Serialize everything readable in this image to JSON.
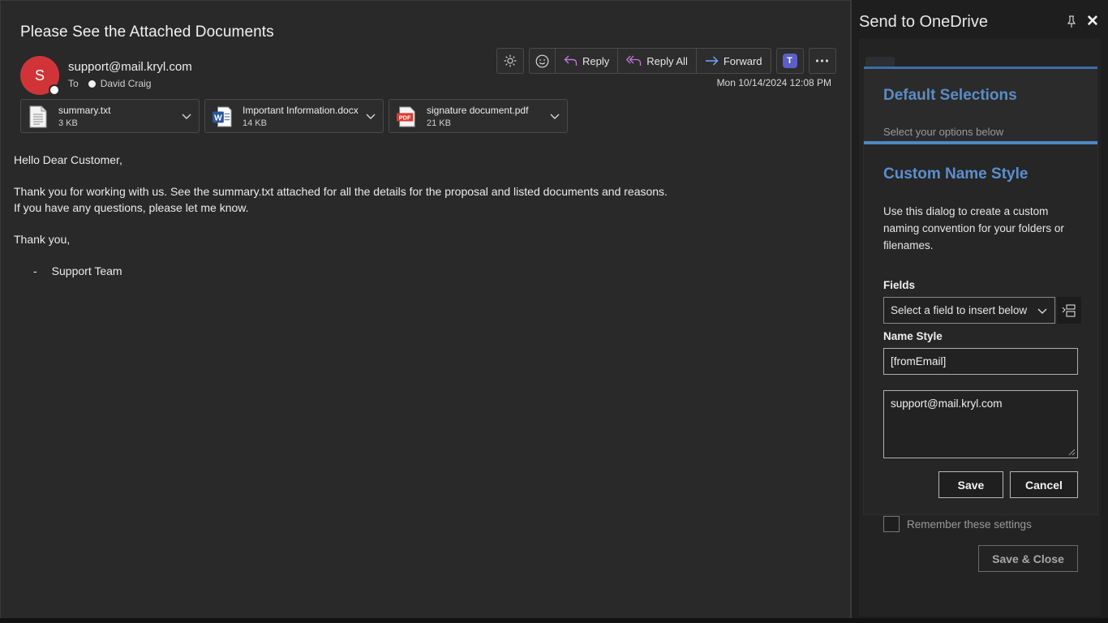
{
  "mail": {
    "subject": "Please See the Attached Documents",
    "avatar_initial": "S",
    "avatar_color": "#d13438",
    "sender": "support@mail.kryl.com",
    "to_label": "To",
    "recipient": "David Craig",
    "datetime": "Mon 10/14/2024 12:08 PM",
    "toolbar": {
      "brightness_icon": "sun-icon",
      "emoji_icon": "smiley-icon",
      "reply_label": "Reply",
      "reply_all_label": "Reply All",
      "forward_label": "Forward",
      "teams_icon": "teams-icon",
      "teams_glyph": "T",
      "more_icon": "more-icon",
      "more_glyph": "⋯"
    },
    "attachments": [
      {
        "name": "summary.txt",
        "size": "3 KB",
        "icon": "text-file-icon"
      },
      {
        "name": "Important Information.docx",
        "size": "14 KB",
        "icon": "word-file-icon"
      },
      {
        "name": "signature document.pdf",
        "size": "21 KB",
        "icon": "pdf-file-icon"
      }
    ],
    "body": {
      "greeting": "Hello Dear Customer,",
      "line1": "Thank you for working with us. See the summary.txt attached for all the details for the proposal and listed documents and reasons.",
      "line2": "If you have any questions, please let me know.",
      "closing": "Thank you,",
      "signature_dash": "-",
      "signature": "Support Team"
    }
  },
  "side_pane": {
    "title": "Send to OneDrive",
    "pin_icon": "pin-icon",
    "close_icon": "close-icon",
    "close_glyph": "✕",
    "default_selections": {
      "title": "Default Selections",
      "subtitle": "Select your options below"
    },
    "dialog": {
      "title": "Custom Name Style",
      "description": "Use this dialog to create a custom naming convention for your folders or filenames.",
      "fields_label": "Fields",
      "fields_select_value": "Select a field to insert below",
      "name_style_label": "Name Style",
      "name_style_value": "[fromEmail]",
      "preview_value": "support@mail.kryl.com",
      "save_label": "Save",
      "cancel_label": "Cancel"
    },
    "remember_label": "Remember these settings",
    "remember_checked": false,
    "save_close_label": "Save & Close",
    "accent_color": "#4f86c6"
  }
}
